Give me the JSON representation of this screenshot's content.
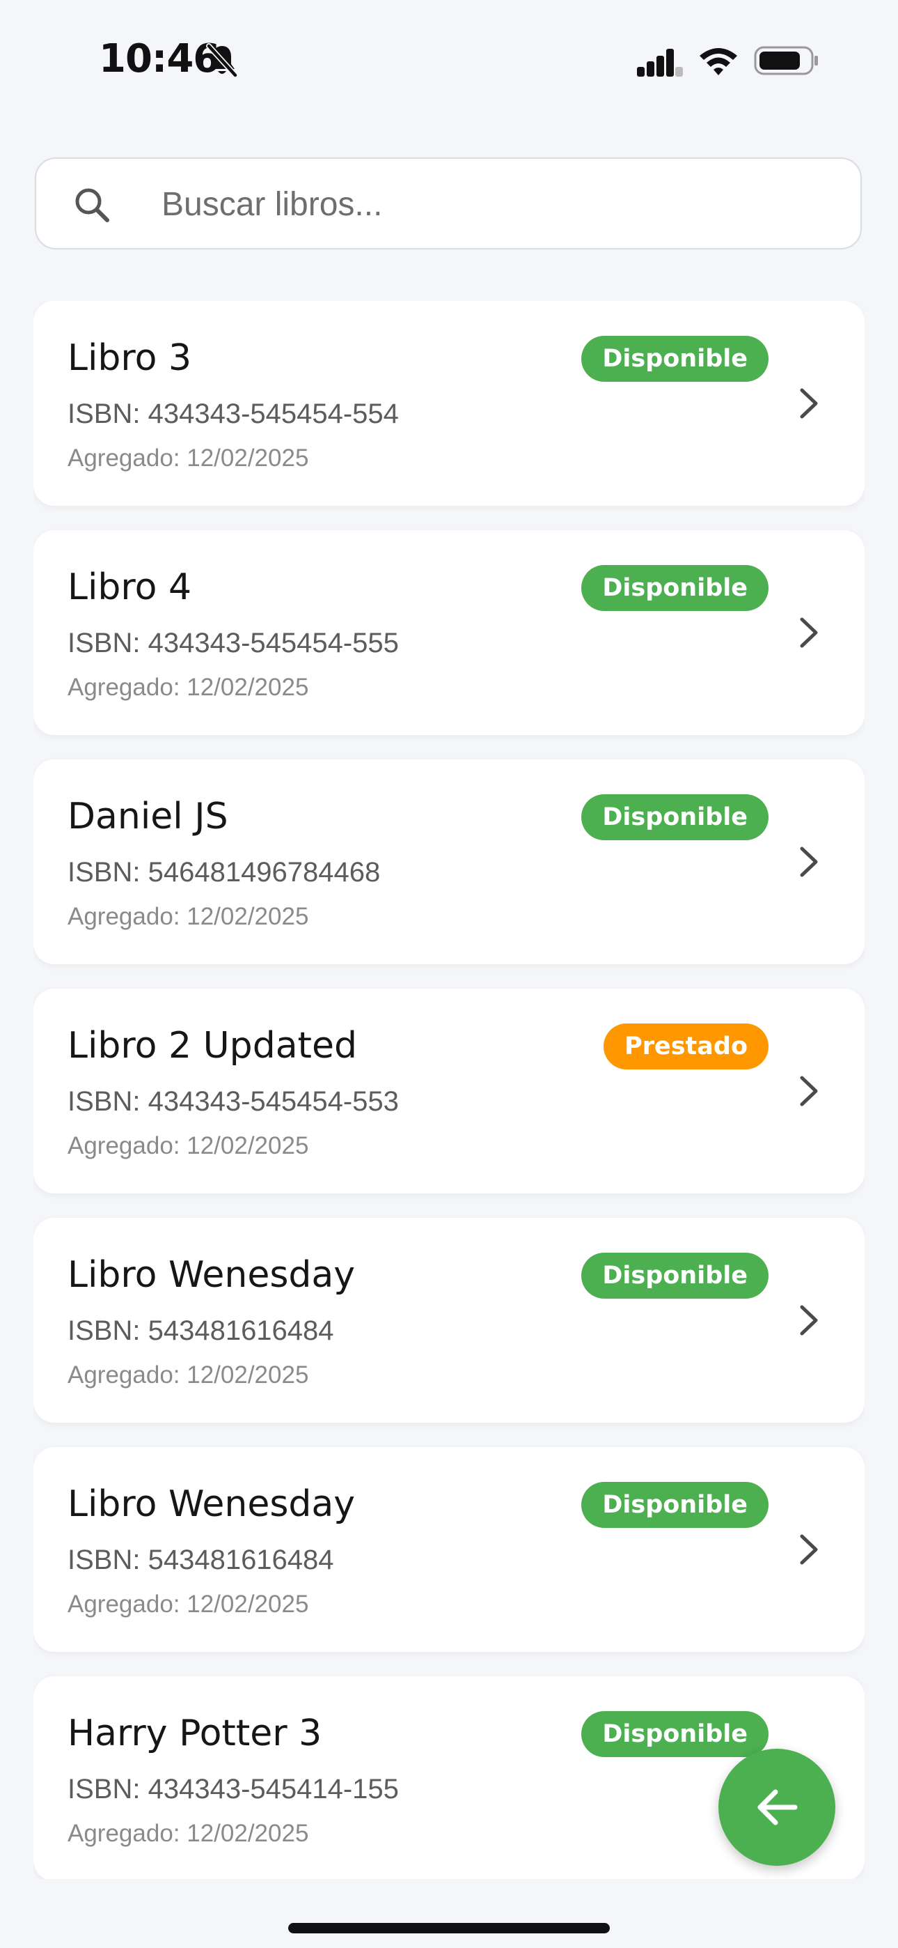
{
  "status_bar": {
    "time": "10:46"
  },
  "search": {
    "placeholder": "Buscar libros..."
  },
  "books": [
    {
      "title": "Libro 3",
      "isbn": "ISBN: 434343-545454-554",
      "added": "Agregado: 12/02/2025",
      "status": "Disponible",
      "status_kind": "available"
    },
    {
      "title": "Libro 4",
      "isbn": "ISBN: 434343-545454-555",
      "added": "Agregado: 12/02/2025",
      "status": "Disponible",
      "status_kind": "available"
    },
    {
      "title": "Daniel JS",
      "isbn": "ISBN: 546481496784468",
      "added": "Agregado: 12/02/2025",
      "status": "Disponible",
      "status_kind": "available"
    },
    {
      "title": "Libro 2 Updated",
      "isbn": "ISBN: 434343-545454-553",
      "added": "Agregado: 12/02/2025",
      "status": "Prestado",
      "status_kind": "loaned"
    },
    {
      "title": "Libro Wenesday",
      "isbn": "ISBN: 543481616484",
      "added": "Agregado: 12/02/2025",
      "status": "Disponible",
      "status_kind": "available"
    },
    {
      "title": "Libro Wenesday",
      "isbn": "ISBN: 543481616484",
      "added": "Agregado: 12/02/2025",
      "status": "Disponible",
      "status_kind": "available"
    },
    {
      "title": "Harry Potter 3",
      "isbn": "ISBN: 434343-545414-155",
      "added": "Agregado: 12/02/2025",
      "status": "Disponible",
      "status_kind": "available"
    }
  ],
  "colors": {
    "available": "#4caf50",
    "loaned": "#ff9800",
    "background": "#f4f6f9",
    "fab": "#4caf50"
  },
  "icons": {
    "notifications": "bell-off-icon",
    "search": "search-icon",
    "row_action": "chevron-right-icon",
    "fab": "arrow-left-icon"
  }
}
